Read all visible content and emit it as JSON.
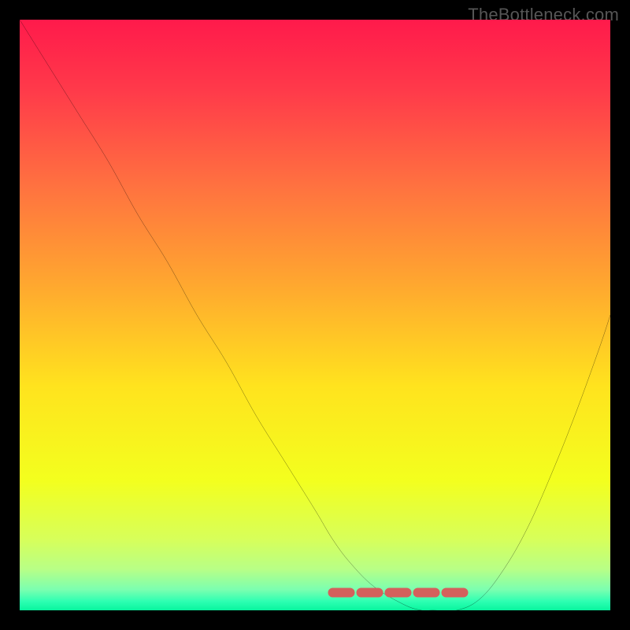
{
  "watermark": "TheBottleneck.com",
  "gradient": {
    "stops": [
      {
        "offset": 0.0,
        "color": "#ff1a4b"
      },
      {
        "offset": 0.12,
        "color": "#ff3a4a"
      },
      {
        "offset": 0.28,
        "color": "#ff7140"
      },
      {
        "offset": 0.45,
        "color": "#ffa82f"
      },
      {
        "offset": 0.62,
        "color": "#ffe31e"
      },
      {
        "offset": 0.78,
        "color": "#f3ff1e"
      },
      {
        "offset": 0.88,
        "color": "#d7ff5a"
      },
      {
        "offset": 0.93,
        "color": "#b8ff86"
      },
      {
        "offset": 0.965,
        "color": "#7bffb0"
      },
      {
        "offset": 0.985,
        "color": "#2dffb2"
      },
      {
        "offset": 1.0,
        "color": "#08f59e"
      }
    ]
  },
  "curve_style": {
    "stroke": "#000000",
    "width": 2
  },
  "plateau_style": {
    "stroke": "#d4605c",
    "width": 12,
    "dash": "22 14",
    "linecap": "round"
  },
  "chart_data": {
    "type": "line",
    "title": "",
    "xlabel": "",
    "ylabel": "",
    "xlim": [
      0,
      100
    ],
    "ylim": [
      0,
      100
    ],
    "series": [
      {
        "name": "curve",
        "x": [
          0,
          5,
          10,
          15,
          20,
          25,
          30,
          35,
          40,
          45,
          50,
          53,
          56,
          60,
          65,
          68,
          70,
          74,
          78,
          82,
          86,
          90,
          94,
          98,
          100
        ],
        "values": [
          100,
          92,
          84,
          76,
          67,
          59,
          50,
          42,
          33,
          25,
          17,
          12,
          8,
          4,
          1,
          0,
          0,
          0,
          2,
          7,
          14,
          23,
          33,
          44,
          50
        ]
      },
      {
        "name": "plateau-marker",
        "x": [
          53,
          77
        ],
        "values": [
          3,
          3
        ]
      }
    ]
  }
}
